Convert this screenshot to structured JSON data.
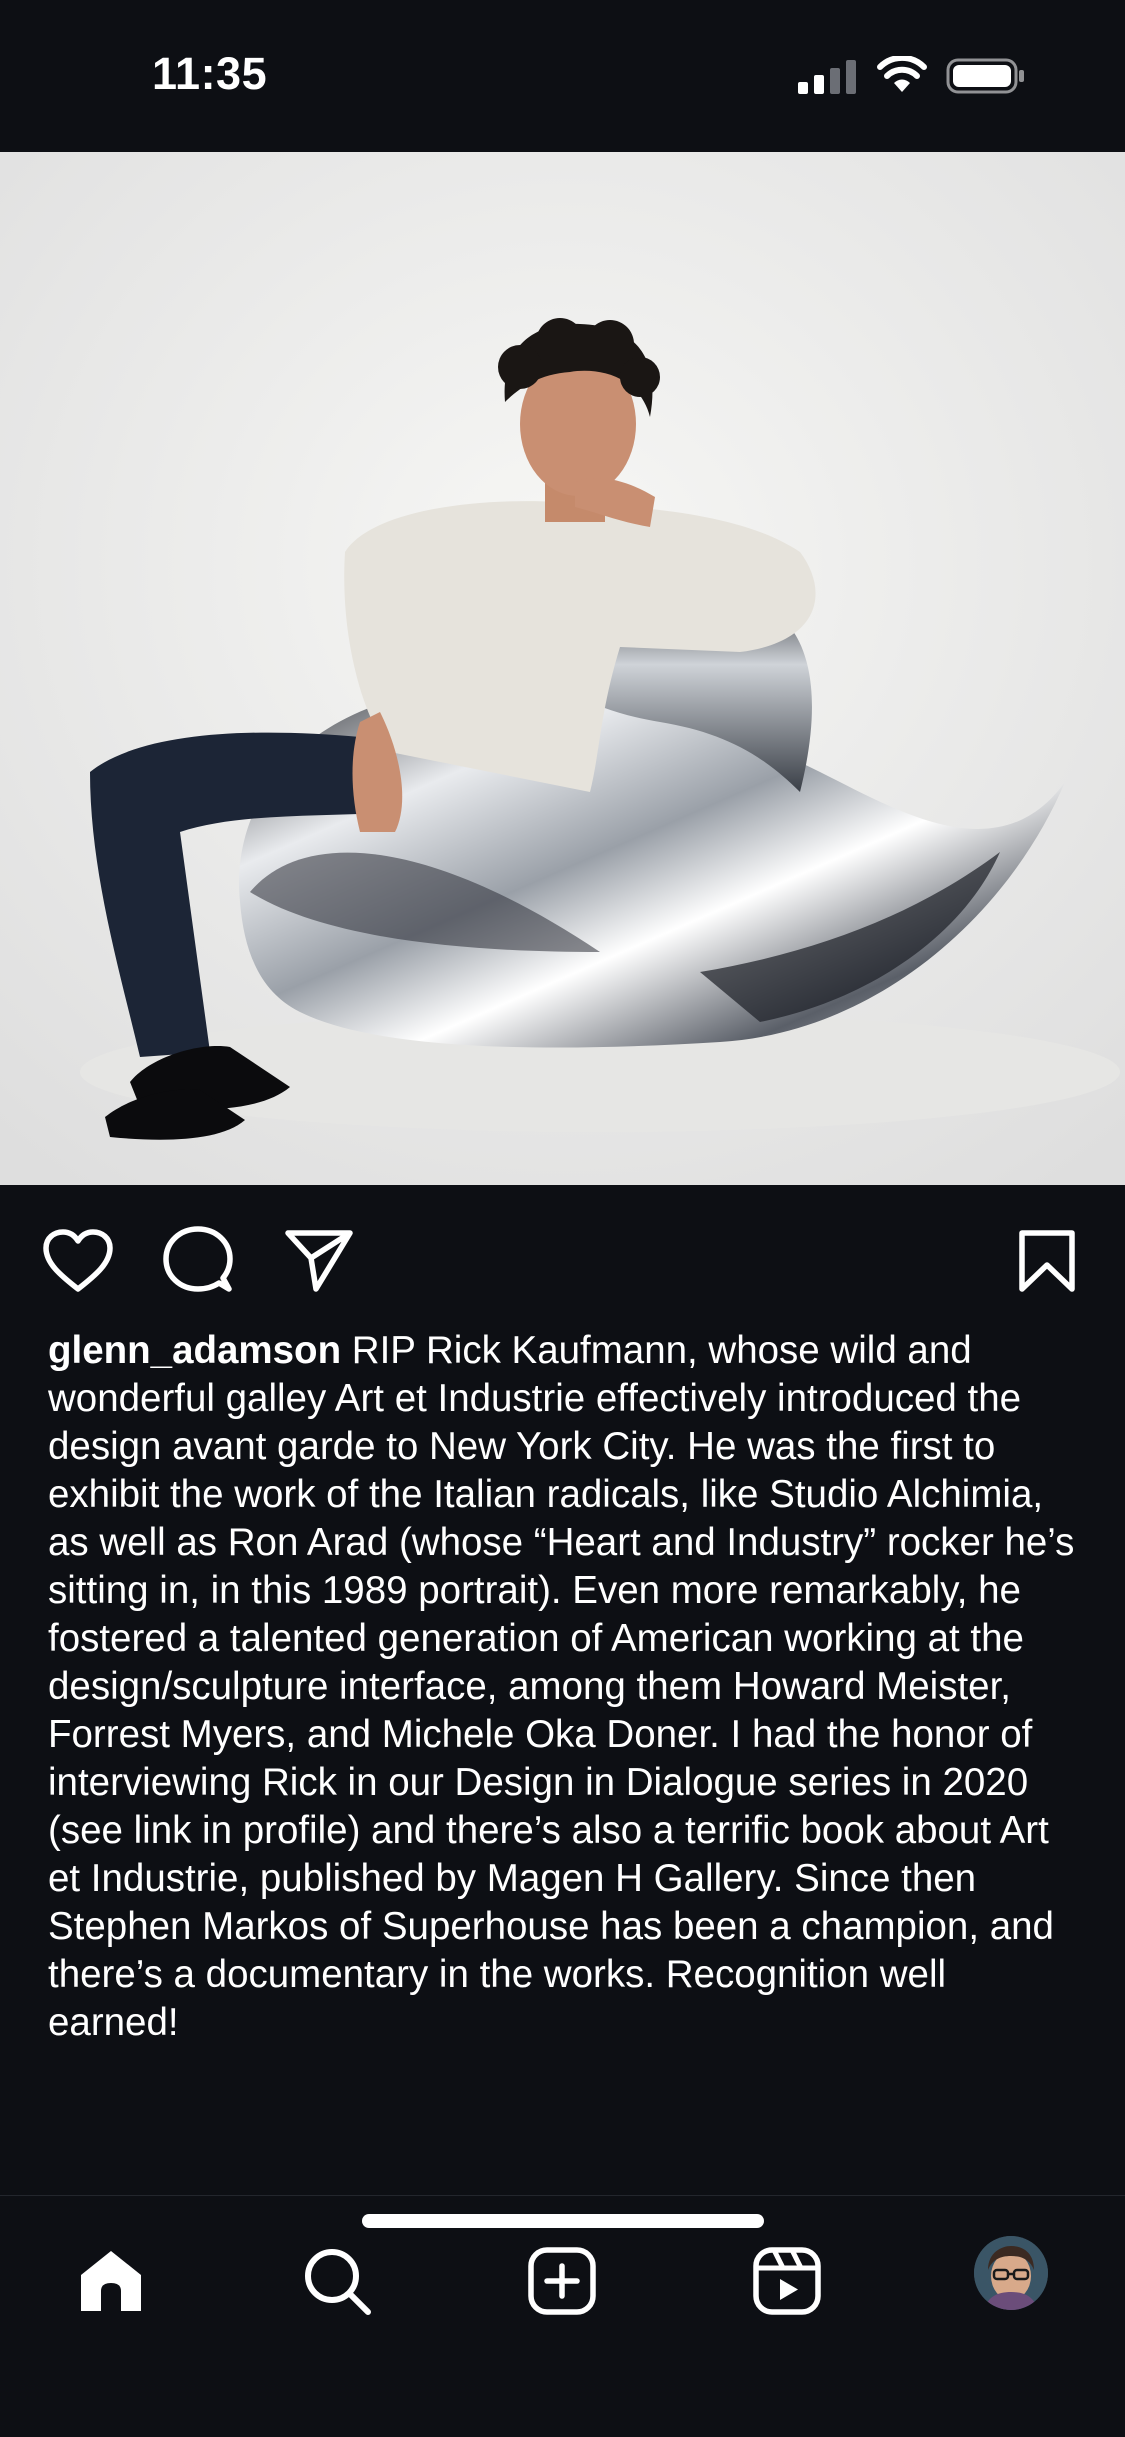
{
  "status_bar": {
    "time": "11:35"
  },
  "post": {
    "username": "glenn_adamson",
    "caption": "RIP Rick Kaufmann, whose wild and wonderful galley Art et Industrie effectively introduced the design avant garde to New York City. He was the first to exhibit the work of the Italian radicals, like Studio Alchimia, as well as Ron Arad (whose “Heart and Industry” rocker he’s sitting in, in this 1989 portrait). Even more remarkably, he fostered a talented generation of American working at the design/sculpture interface, among them Howard Meister, Forrest Myers, and Michele Oka Doner. I had the honor of interviewing Rick in our Design in Dialogue series in 2020 (see link in profile) and there’s also a terrific book about Art et Industrie, published by Magen H Gallery. Since then Stephen Markos of Superhouse has been a champion, and there’s a documentary in the works. Recognition well earned!"
  },
  "icons": {
    "like": "heart-icon",
    "comment": "comment-icon",
    "share": "send-icon",
    "save": "bookmark-icon",
    "home": "home-icon",
    "search": "search-icon",
    "create": "plus-square-icon",
    "reels": "reels-icon",
    "profile": "profile-avatar"
  },
  "colors": {
    "background": "#0d0f14",
    "text": "#ffffff",
    "photo_background": "#f0f0ee"
  }
}
